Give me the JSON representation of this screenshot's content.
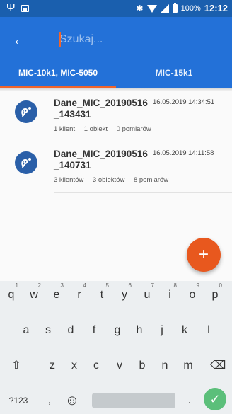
{
  "status_bar": {
    "usb_icon": "usb-icon",
    "battery_text": "100%",
    "time": "12:12"
  },
  "app_bar": {
    "search_placeholder": "Szukaj..."
  },
  "tabs": [
    {
      "label": "MIC-10k1, MIC-5050",
      "active": true
    },
    {
      "label": "MIC-15k1",
      "active": false
    }
  ],
  "files": [
    {
      "name": "Dane_MIC_20190516_143431",
      "date": "16.05.2019 14:34:51",
      "clients": "1 klient",
      "objects": "1 obiekt",
      "measurements": "0 pomiarów"
    },
    {
      "name": "Dane_MIC_20190516_140731",
      "date": "16.05.2019 14:11:58",
      "clients": "3 klientów",
      "objects": "3 obiektów",
      "measurements": "8 pomiarów"
    }
  ],
  "fab": {
    "label": "+"
  },
  "keyboard": {
    "row1": [
      {
        "key": "q",
        "hint": "1"
      },
      {
        "key": "w",
        "hint": "2"
      },
      {
        "key": "e",
        "hint": "3"
      },
      {
        "key": "r",
        "hint": "4"
      },
      {
        "key": "t",
        "hint": "5"
      },
      {
        "key": "y",
        "hint": "6"
      },
      {
        "key": "u",
        "hint": "7"
      },
      {
        "key": "i",
        "hint": "8"
      },
      {
        "key": "o",
        "hint": "9"
      },
      {
        "key": "p",
        "hint": "0"
      }
    ],
    "row2": [
      "a",
      "s",
      "d",
      "f",
      "g",
      "h",
      "j",
      "k",
      "l"
    ],
    "row3": [
      "z",
      "x",
      "c",
      "v",
      "b",
      "n",
      "m"
    ],
    "shift": "⇧",
    "backspace": "⌫",
    "symbols": "?123",
    "comma": ",",
    "emoji": "☺",
    "period": ".",
    "enter": "✓"
  },
  "colors": {
    "primary": "#2371d8",
    "status_bar": "#1a5fae",
    "accent": "#f0642a",
    "fab": "#e8581e"
  }
}
